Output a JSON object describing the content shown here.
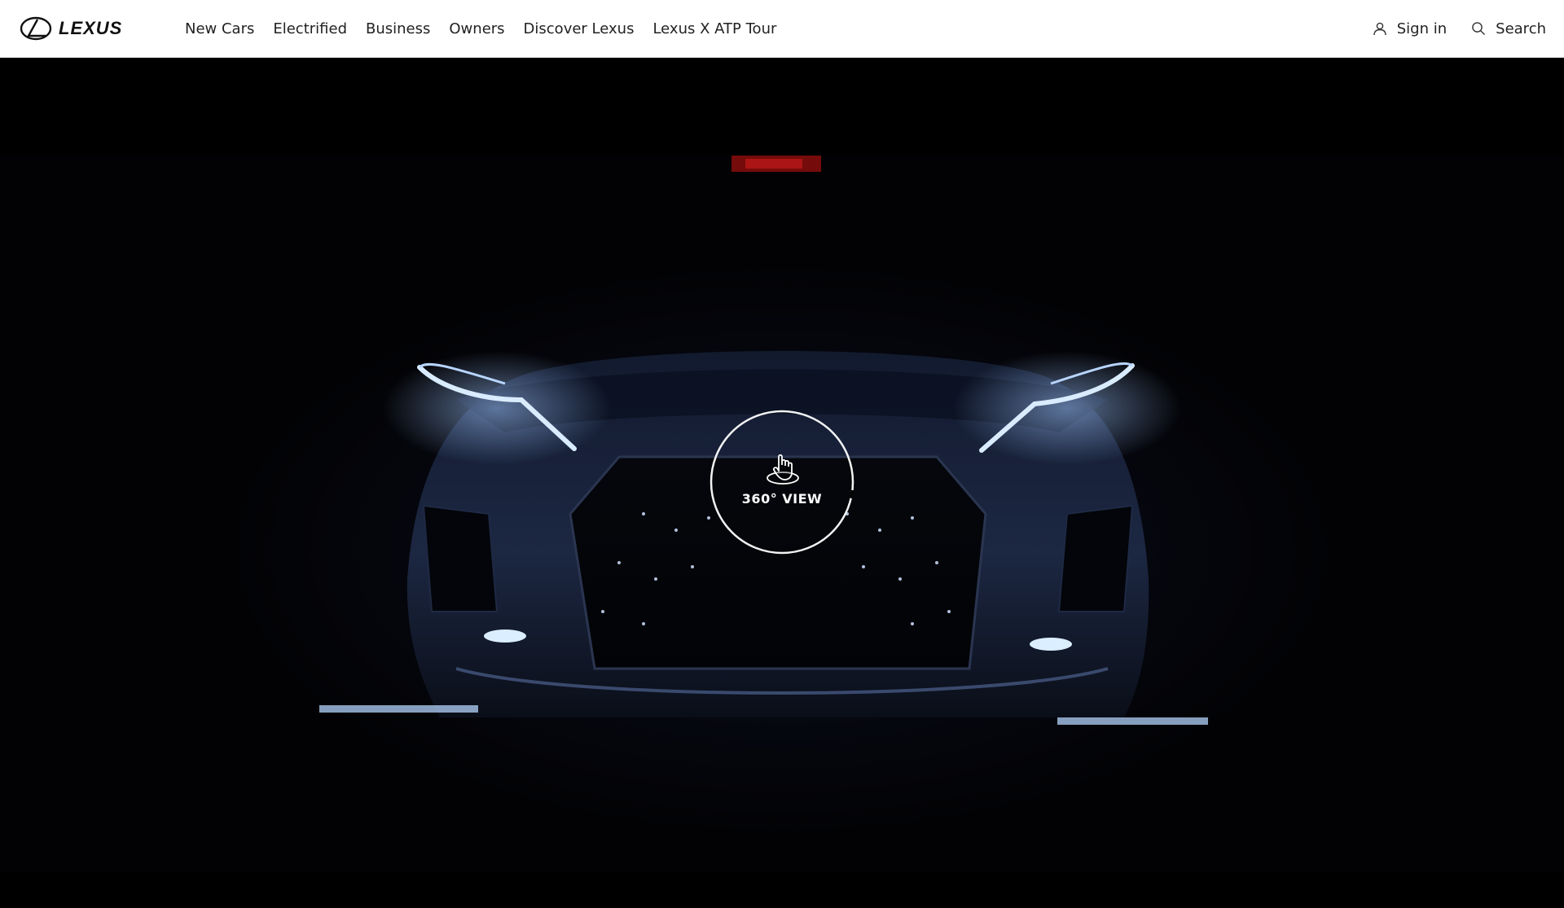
{
  "header": {
    "logo_icon": "lexus-emblem-icon",
    "logo_text": "LEXUS",
    "nav": [
      {
        "label": "New Cars"
      },
      {
        "label": "Electrified"
      },
      {
        "label": "Business"
      },
      {
        "label": "Owners"
      },
      {
        "label": "Discover Lexus"
      },
      {
        "label": "Lexus X ATP Tour"
      }
    ],
    "sign_in": {
      "label": "Sign in",
      "icon": "user-icon"
    },
    "search": {
      "label": "Search",
      "icon": "search-icon"
    }
  },
  "hero": {
    "view360": {
      "label": "360° VIEW",
      "icon": "hand-rotate-icon"
    }
  },
  "colors": {
    "header_bg": "#ffffff",
    "hero_bg": "#000000",
    "headlight": "#cfe6ff",
    "accent_red": "#b31212"
  }
}
